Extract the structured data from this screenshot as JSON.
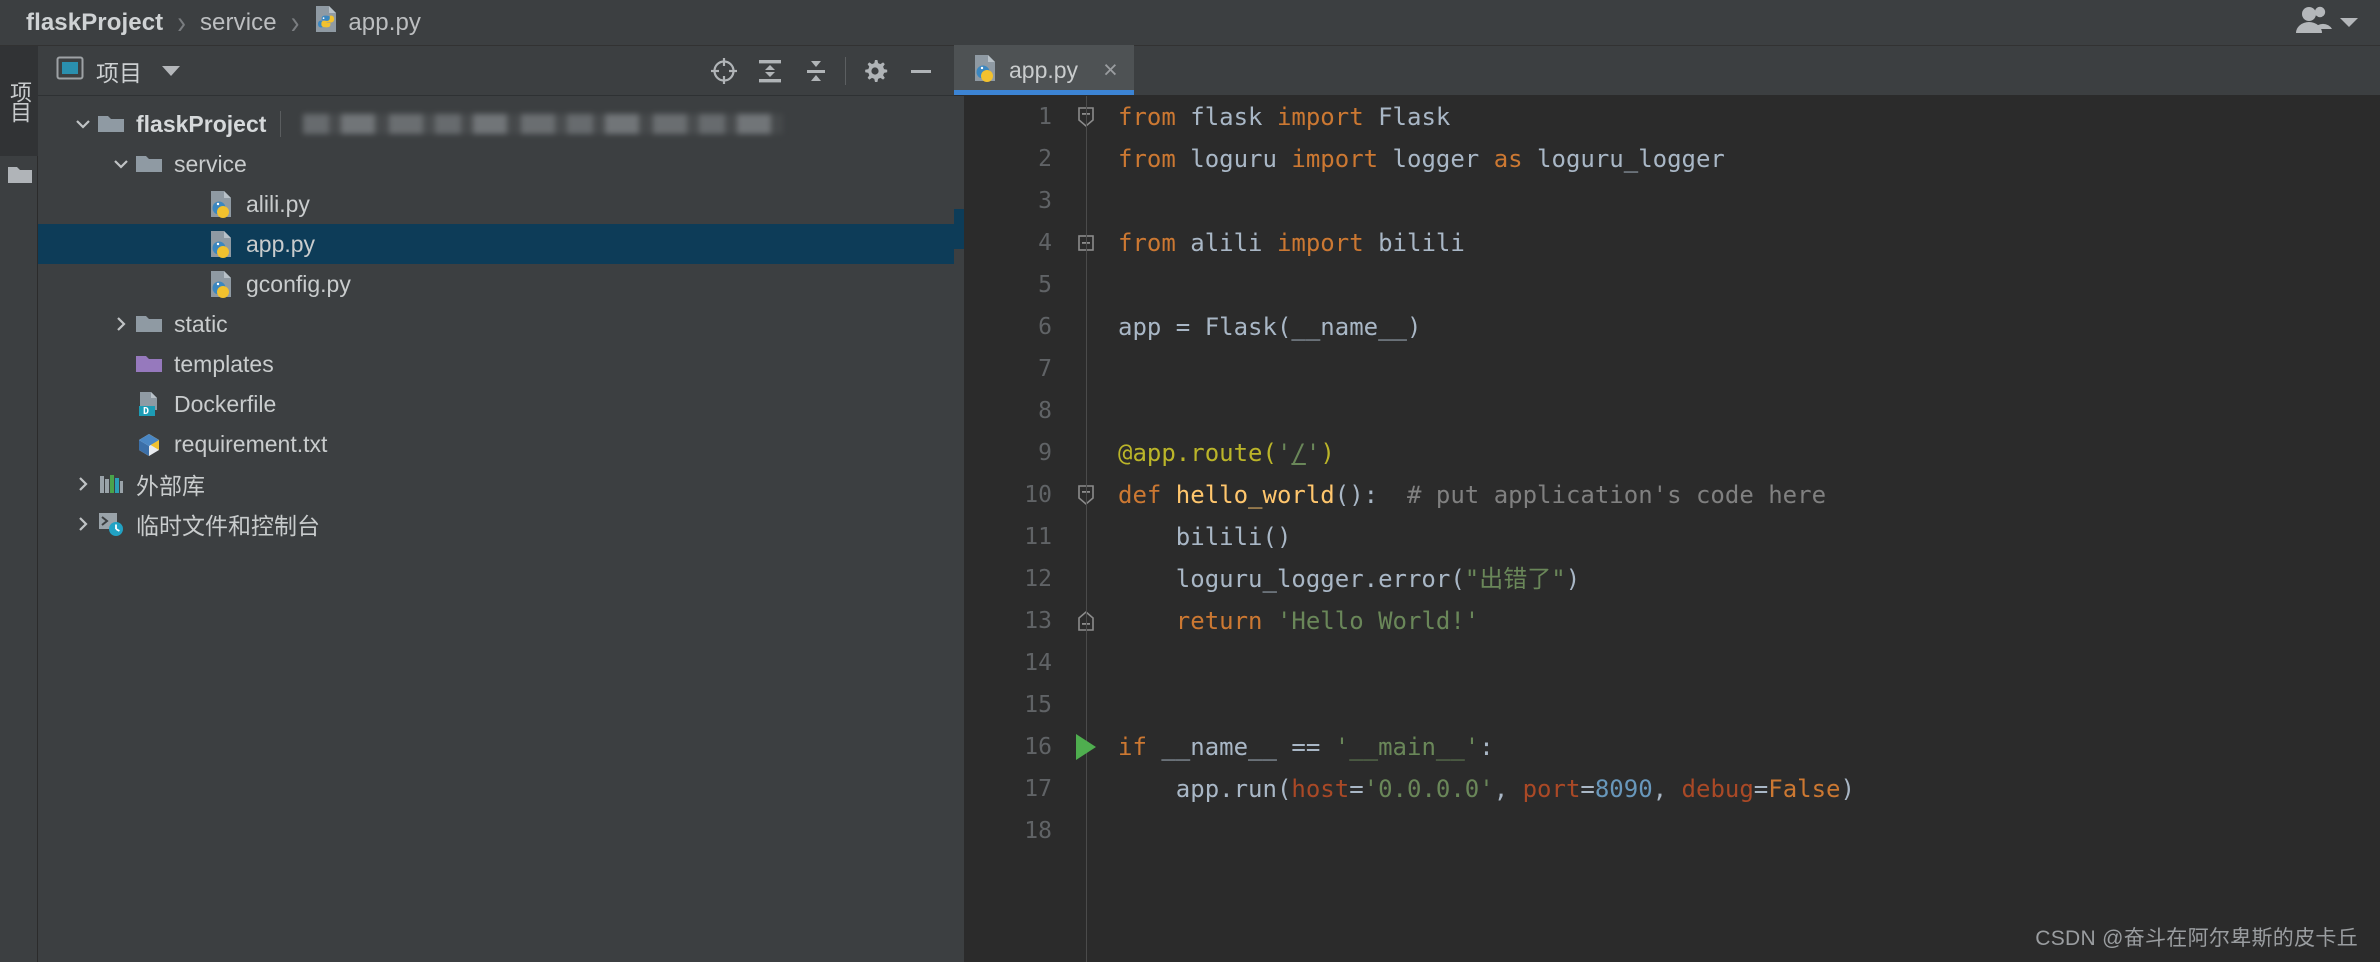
{
  "breadcrumb": {
    "items": [
      {
        "label": "flaskProject",
        "icon": "",
        "bold": true
      },
      {
        "label": "service",
        "icon": "",
        "bold": false
      },
      {
        "label": "app.py",
        "icon": "python-file-icon",
        "bold": false
      }
    ],
    "separator": "›",
    "user_icon": "users-icon",
    "caret_icon": "chevron-down-icon"
  },
  "left_strip": {
    "tab_label": "项目",
    "folder_icon": "folder-icon"
  },
  "project_panel": {
    "title": "项目",
    "title_icon": "project-view-icon",
    "caret_icon": "chevron-down-icon",
    "tools": [
      {
        "name": "locate-file-icon",
        "title": "定位"
      },
      {
        "name": "expand-all-icon",
        "title": "全部展开"
      },
      {
        "name": "collapse-all-icon",
        "title": "全部折叠"
      },
      {
        "name": "settings-gear-icon",
        "title": "设置"
      },
      {
        "name": "hide-panel-icon",
        "title": "隐藏"
      }
    ],
    "tree": [
      {
        "label": "flaskProject",
        "indent": 0,
        "twisty": "expanded",
        "icon": "folder-icon",
        "bold": true,
        "selected": false,
        "blurred_path": true
      },
      {
        "label": "service",
        "indent": 1,
        "twisty": "expanded",
        "icon": "folder-icon",
        "bold": false,
        "selected": false,
        "blurred_path": false
      },
      {
        "label": "alili.py",
        "indent": 2,
        "twisty": "none",
        "icon": "python-file-icon",
        "bold": false,
        "selected": false,
        "blurred_path": false
      },
      {
        "label": "app.py",
        "indent": 2,
        "twisty": "none",
        "icon": "python-file-icon",
        "bold": false,
        "selected": true,
        "blurred_path": false
      },
      {
        "label": "gconfig.py",
        "indent": 2,
        "twisty": "none",
        "icon": "python-file-icon",
        "bold": false,
        "selected": false,
        "blurred_path": false
      },
      {
        "label": "static",
        "indent": 1,
        "twisty": "collapsed",
        "icon": "folder-icon",
        "bold": false,
        "selected": false,
        "blurred_path": false
      },
      {
        "label": "templates",
        "indent": 1,
        "twisty": "none",
        "icon": "folder-purple-icon",
        "bold": false,
        "selected": false,
        "blurred_path": false
      },
      {
        "label": "Dockerfile",
        "indent": 1,
        "twisty": "none",
        "icon": "dockerfile-icon",
        "bold": false,
        "selected": false,
        "blurred_path": false
      },
      {
        "label": "requirement.txt",
        "indent": 1,
        "twisty": "none",
        "icon": "requirements-icon",
        "bold": false,
        "selected": false,
        "blurred_path": false
      },
      {
        "label": "外部库",
        "indent": 0,
        "twisty": "collapsed",
        "icon": "external-libraries-icon",
        "bold": false,
        "selected": false,
        "blurred_path": false
      },
      {
        "label": "临时文件和控制台",
        "indent": 0,
        "twisty": "collapsed",
        "icon": "scratches-consoles-icon",
        "bold": false,
        "selected": false,
        "blurred_path": false
      }
    ]
  },
  "editor": {
    "tabs": [
      {
        "label": "app.py",
        "icon": "python-file-icon",
        "close": "×",
        "active": true
      }
    ],
    "line_numbers": [
      "1",
      "2",
      "3",
      "4",
      "5",
      "6",
      "7",
      "8",
      "9",
      "10",
      "11",
      "12",
      "13",
      "14",
      "15",
      "16",
      "17",
      "18"
    ],
    "gutter_markers": {
      "fold_expanded_lines": [
        1,
        4,
        10
      ],
      "fold_end_lines": [
        13
      ],
      "run_arrow_line": 16
    },
    "code_text": [
      "from flask import Flask",
      "from loguru import logger as loguru_logger",
      "",
      "from alili import bilili",
      "",
      "app = Flask(__name__)",
      "",
      "",
      "@app.route('/')",
      "def hello_world():  # put application's code here",
      "    bilili()",
      "    loguru_logger.error(\"出错了\")",
      "    return 'Hello World!'",
      "",
      "",
      "if __name__ == '__main__':",
      "    app.run(host='0.0.0.0', port=8090, debug=False)",
      ""
    ]
  },
  "watermark": "CSDN @奋斗在阿尔卑斯的皮卡丘",
  "colors": {
    "panel_bg": "#3c3f41",
    "editor_bg": "#2b2b2b",
    "selection_blue": "#0d3c58",
    "tab_underline": "#3c84d4",
    "keyword_orange": "#cc7832",
    "string_green": "#6a8759",
    "number_blue": "#6897bb",
    "decorator_yellow": "#bbb529",
    "function_yellow": "#ffc66d",
    "comment_grey": "#808080",
    "run_green": "#4fae4f"
  }
}
